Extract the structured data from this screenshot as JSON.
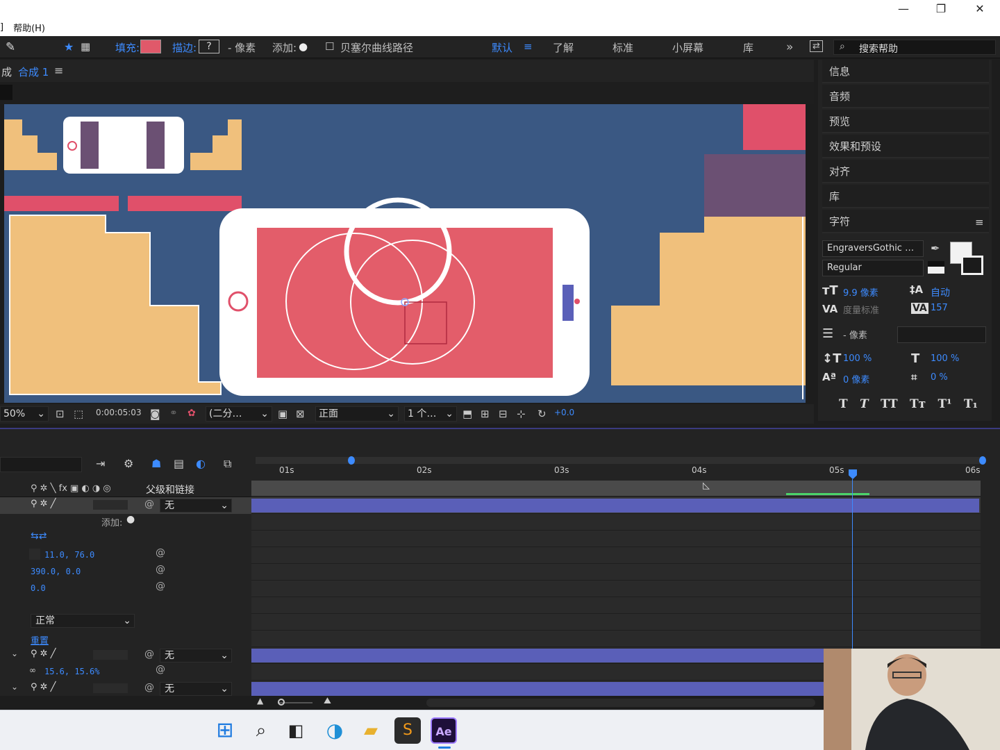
{
  "window": {
    "menu": [
      "帮助(H)"
    ],
    "controls": [
      "—",
      "❐",
      "✕"
    ]
  },
  "toolbar": {
    "fill_label": "填充:",
    "stroke_label": "描边:",
    "stroke_value": "?",
    "pixel_label": "- 像素",
    "add_label": "添加:",
    "bezier_label": "贝塞尔曲线路径",
    "workspaces": [
      "默认",
      "了解",
      "标准",
      "小屏幕",
      "库"
    ],
    "more": "»",
    "search_placeholder": "搜索帮助",
    "fill_color": "#e0596a"
  },
  "composition": {
    "tab_prefix": "合成",
    "tab_name": "合成 1",
    "menu_icon": "≡",
    "zoom": "50%",
    "timecode": "0:00:05:03",
    "resolution": "(二分…",
    "view": "正面",
    "views_count": "1 个…",
    "exposure": "+0.0"
  },
  "right_panel": {
    "items": [
      "信息",
      "音频",
      "预览",
      "效果和预设",
      "对齐",
      "库",
      "字符"
    ],
    "character": {
      "font": "EngraversGothic …",
      "style": "Regular",
      "size": "9.9 像素",
      "leading": "自动",
      "kerning": "度量标准",
      "tracking": "157",
      "stroke_width": "- 像素",
      "v_scale": "100 %",
      "h_scale": "100 %",
      "baseline": "0 像素",
      "tsume": "0 %",
      "styles": [
        "T",
        "T",
        "TT",
        "Tт",
        "T¹",
        "T₁"
      ]
    }
  },
  "timeline": {
    "header_parent": "父级和链接",
    "time_markers": [
      "01s",
      "02s",
      "03s",
      "04s",
      "05s",
      "06s"
    ],
    "layers": [
      {
        "parent": "无"
      },
      {
        "parent": "无"
      },
      {
        "parent": "无"
      }
    ],
    "add_label": "添加:",
    "anchor": "11.0, 76.0",
    "position": "390.0, 0.0",
    "rotation": "0.0",
    "blend_mode": "正常",
    "reset": "重置",
    "scale": "15.6, 15.6%"
  },
  "taskbar": {
    "icons": [
      "windows-start",
      "search",
      "task-view",
      "edge",
      "file-explorer",
      "sublime",
      "after-effects"
    ],
    "ae_label": "Ae"
  },
  "colors": {
    "bg_blue": "#3a5883",
    "tan": "#f0c07c",
    "pink": "#e0506a",
    "mauve": "#6b5073",
    "phone_screen": "#e35d6a"
  }
}
